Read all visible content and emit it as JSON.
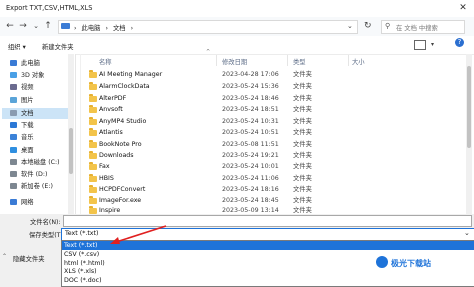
{
  "window": {
    "title": "Export TXT,CSV,HTML,XLS"
  },
  "address": {
    "path": [
      "此电脑",
      "文档"
    ],
    "separator": "›"
  },
  "search": {
    "placeholder": "在 文档 中搜索"
  },
  "toolbar": {
    "organize": "组织 ▾",
    "new_folder": "新建文件夹"
  },
  "sidebar": {
    "items": [
      {
        "label": "此电脑",
        "icon": "computer-icon"
      },
      {
        "label": "3D 对象",
        "icon": "cube-icon"
      },
      {
        "label": "视频",
        "icon": "video-icon"
      },
      {
        "label": "图片",
        "icon": "picture-icon"
      },
      {
        "label": "文档",
        "icon": "document-icon",
        "selected": true
      },
      {
        "label": "下载",
        "icon": "download-icon"
      },
      {
        "label": "音乐",
        "icon": "music-icon"
      },
      {
        "label": "桌面",
        "icon": "desktop-icon"
      },
      {
        "label": "本地磁盘 (C:)",
        "icon": "drive-icon"
      },
      {
        "label": "软件 (D:)",
        "icon": "drive-icon"
      },
      {
        "label": "新加卷 (E:)",
        "icon": "drive-icon"
      },
      {
        "label": "网络",
        "icon": "network-icon"
      }
    ]
  },
  "columns": {
    "name": "名称",
    "date": "修改日期",
    "type": "类型",
    "size": "大小"
  },
  "files": [
    {
      "name": "AI Meeting Manager",
      "date": "2023-04-28 17:06",
      "type": "文件夹"
    },
    {
      "name": "AlarmClockData",
      "date": "2023-05-24 15:36",
      "type": "文件夹"
    },
    {
      "name": "AlterPDF",
      "date": "2023-05-24 18:46",
      "type": "文件夹"
    },
    {
      "name": "Anvsoft",
      "date": "2023-05-24 18:51",
      "type": "文件夹"
    },
    {
      "name": "AnyMP4 Studio",
      "date": "2023-05-24 10:31",
      "type": "文件夹"
    },
    {
      "name": "Atlantis",
      "date": "2023-05-24 10:51",
      "type": "文件夹"
    },
    {
      "name": "BookNote Pro",
      "date": "2023-05-08 11:51",
      "type": "文件夹"
    },
    {
      "name": "Downloads",
      "date": "2023-05-24 19:21",
      "type": "文件夹"
    },
    {
      "name": "Fax",
      "date": "2023-05-24 10:01",
      "type": "文件夹"
    },
    {
      "name": "HBIS",
      "date": "2023-05-24 11:06",
      "type": "文件夹"
    },
    {
      "name": "HCPDFConvert",
      "date": "2023-05-24 18:16",
      "type": "文件夹"
    },
    {
      "name": "ImageFor.exe",
      "date": "2023-05-24 18:45",
      "type": "文件夹"
    },
    {
      "name": "Inspire",
      "date": "2023-05-09 13:14",
      "type": "文件夹"
    }
  ],
  "form": {
    "filename_label": "文件名(N):",
    "filename_value": "",
    "filetype_label": "保存类型(T):",
    "filetype_value": "Text (*.txt)"
  },
  "filetype_options": [
    "Text (*.txt)",
    "CSV (*.csv)",
    "html (*.html)",
    "XLS (*.xls)",
    "DOC (*.doc)"
  ],
  "hide_folders": "隐藏文件夹",
  "watermark": "极光下载站"
}
